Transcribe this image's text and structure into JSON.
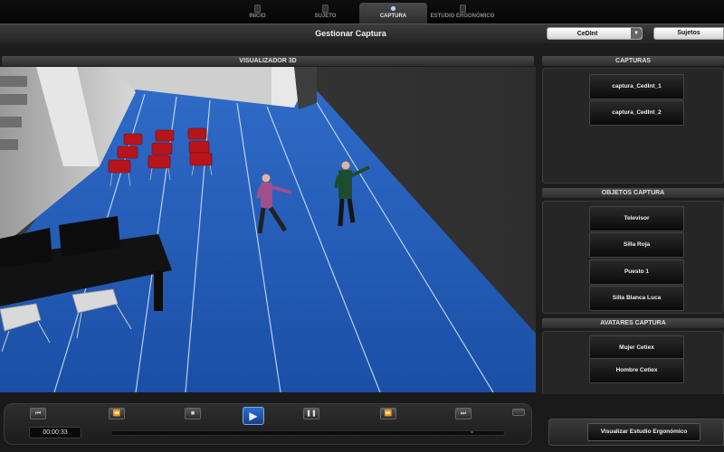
{
  "nav": {
    "tabs": [
      {
        "label": "INICIO"
      },
      {
        "label": "SUJETO"
      },
      {
        "label": "CAPTURA"
      },
      {
        "label": "ESTUDIO ERGONÓMICO"
      }
    ]
  },
  "header": {
    "title": "Gestionar Captura",
    "dropdown_value": "CeDInt",
    "subjects_button": "Sujetos"
  },
  "viewer": {
    "title": "VISUALIZADOR 3D"
  },
  "sidebar": {
    "captures_title": "CAPTURAS",
    "captures": [
      "captura_CedInt_1",
      "captura_CedInt_2"
    ],
    "objects_title": "OBJETOS CAPTURA",
    "objects": [
      "Televisor",
      "Silla Roja",
      "Puesto 1",
      "Silla Blanca Luca"
    ],
    "avatars_title": "AVATARES CAPTURA",
    "avatars": [
      "Mujer Cetiex",
      "Hombre Cetiex"
    ]
  },
  "player": {
    "time": "00:00:33",
    "ergonomic_button": "Visualizar Estudio Ergonómico"
  },
  "colors": {
    "accent_blue": "#2b6fd1",
    "floor_blue": "#1f56b0"
  }
}
